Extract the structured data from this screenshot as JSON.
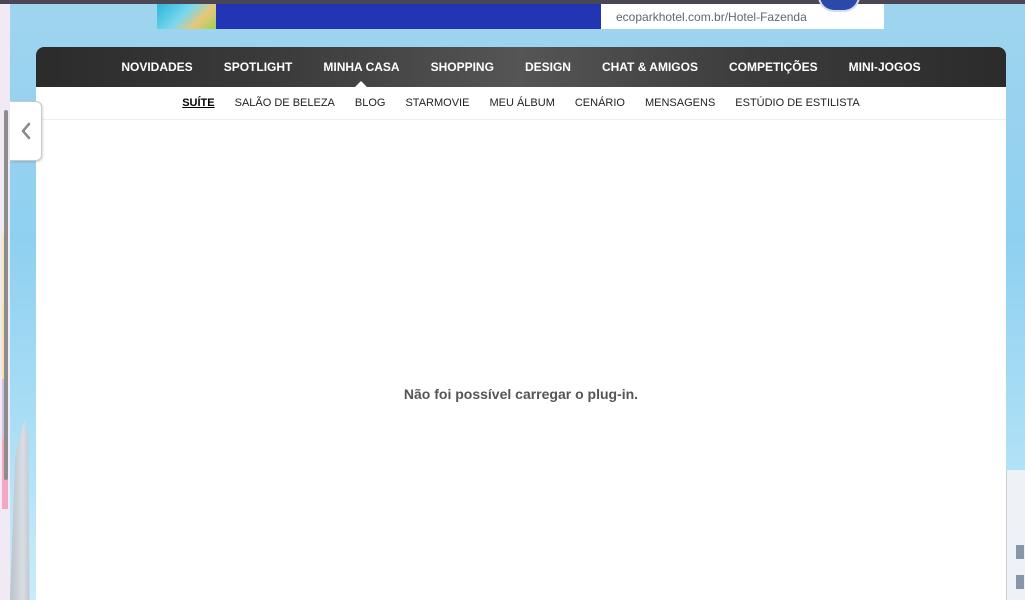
{
  "banner": {
    "url_text": "ecoparkhotel.com.br/Hotel-Fazenda"
  },
  "main_nav": {
    "items": [
      {
        "label": "NOVIDADES"
      },
      {
        "label": "SPOTLIGHT"
      },
      {
        "label": "MINHA CASA",
        "active": true
      },
      {
        "label": "SHOPPING"
      },
      {
        "label": "DESIGN"
      },
      {
        "label": "CHAT & AMIGOS"
      },
      {
        "label": "COMPETIÇÕES"
      },
      {
        "label": "MINI-JOGOS"
      }
    ]
  },
  "sub_nav": {
    "items": [
      {
        "label": "SUÍTE",
        "active": true
      },
      {
        "label": "SALÃO DE BELEZA"
      },
      {
        "label": "BLOG"
      },
      {
        "label": "STARMOVIE"
      },
      {
        "label": "MEU ÁLBUM"
      },
      {
        "label": "CENÁRIO"
      },
      {
        "label": "MENSAGENS"
      },
      {
        "label": "ESTÚDIO DE ESTILISTA"
      }
    ]
  },
  "content": {
    "plugin_message": "Não foi possível carregar o plug-in."
  },
  "icons": {
    "side_handle": "chevron-left-icon"
  },
  "colors": {
    "nav_dark": "#2b2b2b",
    "sky": "#8fd0f0",
    "banner_blue": "#2135b5"
  }
}
